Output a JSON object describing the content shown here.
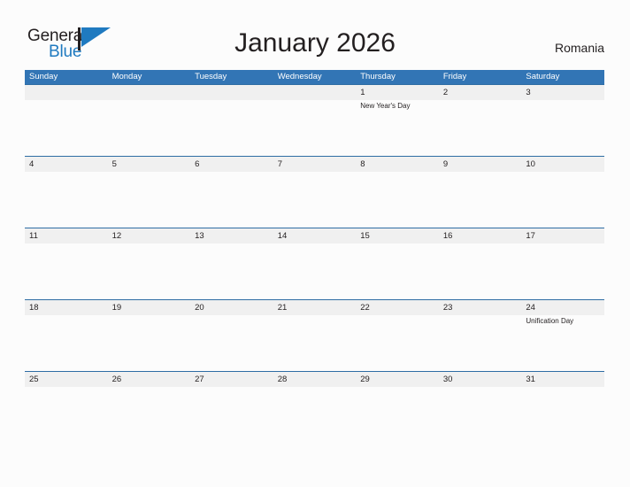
{
  "brand": {
    "name_part1": "General",
    "name_part2": "Blue",
    "flag_icon": "flag-triangle-icon",
    "accent_color": "#1f7ac0",
    "text_color": "#231f20"
  },
  "header": {
    "title": "January 2026",
    "country": "Romania"
  },
  "calendar": {
    "header_bg": "#3275b5",
    "row_border": "#2e6da4",
    "band_bg": "#f0f0f0",
    "weekdays": [
      "Sunday",
      "Monday",
      "Tuesday",
      "Wednesday",
      "Thursday",
      "Friday",
      "Saturday"
    ],
    "weeks": [
      [
        {
          "day": "",
          "event": ""
        },
        {
          "day": "",
          "event": ""
        },
        {
          "day": "",
          "event": ""
        },
        {
          "day": "",
          "event": ""
        },
        {
          "day": "1",
          "event": "New Year's Day"
        },
        {
          "day": "2",
          "event": ""
        },
        {
          "day": "3",
          "event": ""
        }
      ],
      [
        {
          "day": "4",
          "event": ""
        },
        {
          "day": "5",
          "event": ""
        },
        {
          "day": "6",
          "event": ""
        },
        {
          "day": "7",
          "event": ""
        },
        {
          "day": "8",
          "event": ""
        },
        {
          "day": "9",
          "event": ""
        },
        {
          "day": "10",
          "event": ""
        }
      ],
      [
        {
          "day": "11",
          "event": ""
        },
        {
          "day": "12",
          "event": ""
        },
        {
          "day": "13",
          "event": ""
        },
        {
          "day": "14",
          "event": ""
        },
        {
          "day": "15",
          "event": ""
        },
        {
          "day": "16",
          "event": ""
        },
        {
          "day": "17",
          "event": ""
        }
      ],
      [
        {
          "day": "18",
          "event": ""
        },
        {
          "day": "19",
          "event": ""
        },
        {
          "day": "20",
          "event": ""
        },
        {
          "day": "21",
          "event": ""
        },
        {
          "day": "22",
          "event": ""
        },
        {
          "day": "23",
          "event": ""
        },
        {
          "day": "24",
          "event": "Unification Day"
        }
      ],
      [
        {
          "day": "25",
          "event": ""
        },
        {
          "day": "26",
          "event": ""
        },
        {
          "day": "27",
          "event": ""
        },
        {
          "day": "28",
          "event": ""
        },
        {
          "day": "29",
          "event": ""
        },
        {
          "day": "30",
          "event": ""
        },
        {
          "day": "31",
          "event": ""
        }
      ]
    ]
  }
}
